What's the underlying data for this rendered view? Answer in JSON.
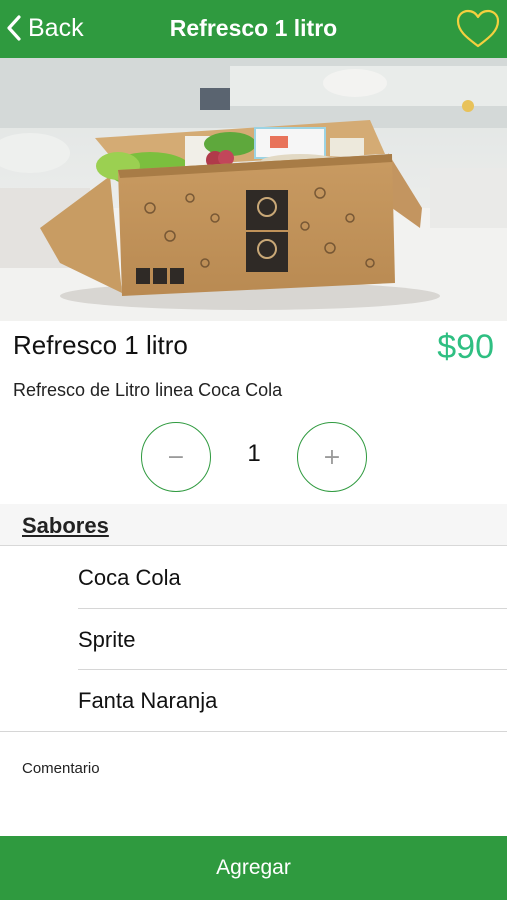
{
  "nav": {
    "back_label": "Back",
    "title": "Refresco 1 litro",
    "favorite_icon": "heart-outline-icon",
    "back_icon": "chevron-left-icon"
  },
  "product": {
    "name": "Refresco 1 litro",
    "price": "$90",
    "description": "Refresco de Litro linea Coca Cola",
    "image": "product-box-photo"
  },
  "stepper": {
    "minus_symbol": "−",
    "plus_symbol": "+",
    "quantity": "1"
  },
  "section": {
    "title": "Sabores"
  },
  "flavors": [
    {
      "label": "Coca Cola"
    },
    {
      "label": "Sprite"
    },
    {
      "label": "Fanta Naranja"
    }
  ],
  "comment": {
    "label": "Comentario",
    "value": ""
  },
  "action": {
    "add_label": "Agregar"
  },
  "colors": {
    "primary_green": "#2f9a3f",
    "price_green": "#2fbf82",
    "heart_yellow": "#f4d03f"
  }
}
